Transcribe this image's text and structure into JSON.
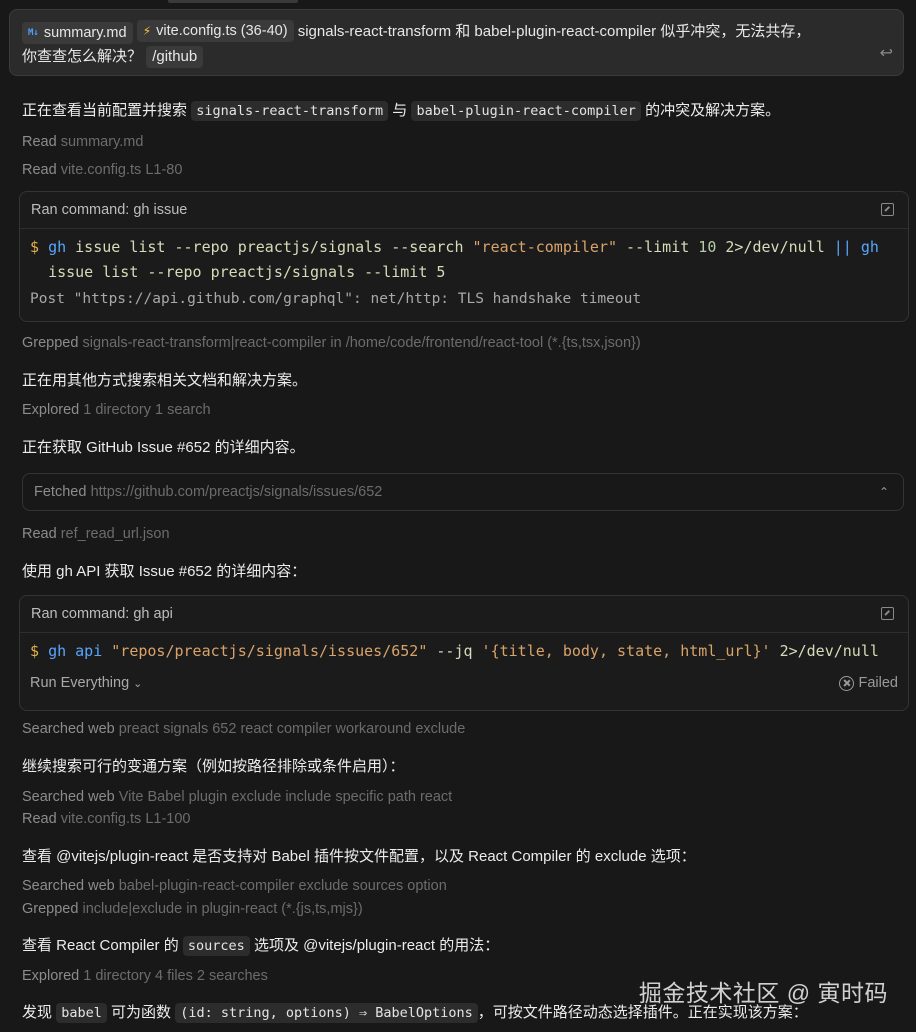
{
  "prompt": {
    "chip1": {
      "icon": "M↓",
      "label": "summary.md"
    },
    "chip2": {
      "icon": "⚡",
      "label": "vite.config.ts (36-40)"
    },
    "text_a": "signals-react-transform 和 babel-plugin-react-compiler 似乎冲突，无法共存，",
    "text_b": "你查查怎么解决？",
    "command_chip": "/github"
  },
  "m1": {
    "pre": "正在查看当前配置并搜索",
    "c1": "signals-react-transform",
    "mid": "与",
    "c2": "babel-plugin-react-compiler",
    "post": "的冲突及解决方案。"
  },
  "read1": {
    "verb": "Read",
    "detail": "summary.md"
  },
  "read2": {
    "verb": "Read",
    "detail": "vite.config.ts L1-80"
  },
  "card1": {
    "title": "Ran command: gh issue",
    "dollar": "$",
    "t1": "gh",
    "t2": "issue list --repo preactjs/signals --search",
    "t3": "\"react-compiler\"",
    "t4": "--limit",
    "t5": "10",
    "t6": "2>/dev/null",
    "t7": "||",
    "t8": "gh",
    "t9": "issue list --repo preactjs/signals --limit 5",
    "output": "Post \"https://api.github.com/graphql\": net/http: TLS handshake timeout"
  },
  "grep1": {
    "verb": "Grepped",
    "detail": "signals-react-transform|react-compiler in /home/code/frontend/react-tool (*.{ts,tsx,json})"
  },
  "m2": "正在用其他方式搜索相关文档和解决方案。",
  "explored1": {
    "verb": "Explored",
    "detail": "1 directory 1 search"
  },
  "m3": "正在获取 GitHub Issue #652 的详细内容。",
  "fetched": {
    "verb": "Fetched",
    "detail": "https://github.com/preactjs/signals/issues/652"
  },
  "read3": {
    "verb": "Read",
    "detail": "ref_read_url.json"
  },
  "m4": "使用 gh API 获取 Issue #652 的详细内容：",
  "card2": {
    "title": "Ran command: gh api",
    "dollar": "$",
    "t1": "gh",
    "t2": "api",
    "t3": "\"repos/preactjs/signals/issues/652\"",
    "t4": "--jq",
    "t5": "'{title, body, state, html_url}'",
    "t6": "2>/dev/null",
    "run_label": "Run Everything",
    "status": "Failed"
  },
  "search1": {
    "verb": "Searched web",
    "detail": "preact signals 652 react compiler workaround exclude"
  },
  "m5": "继续搜索可行的变通方案（例如按路径排除或条件启用）：",
  "search2": {
    "verb": "Searched web",
    "detail": "Vite Babel plugin exclude include specific path react"
  },
  "read4": {
    "verb": "Read",
    "detail": "vite.config.ts L1-100"
  },
  "m6": "查看 @vitejs/plugin-react 是否支持对 Babel 插件按文件配置，以及 React Compiler 的 exclude 选项：",
  "search3": {
    "verb": "Searched web",
    "detail": "babel-plugin-react-compiler exclude sources option"
  },
  "grep2": {
    "verb": "Grepped",
    "detail": "include|exclude in plugin-react (*.{js,ts,mjs})"
  },
  "m7": {
    "pre": "查看 React Compiler 的",
    "c1": "sources",
    "post": "选项及 @vitejs/plugin-react 的用法："
  },
  "explored2": {
    "verb": "Explored",
    "detail": "1 directory 4 files 2 searches"
  },
  "m8": {
    "pre": "发现",
    "c1": "babel",
    "mid": "可为函数",
    "c2": "(id: string, options) ⇒ BabelOptions",
    "post": "，可按文件路径动态选择插件。正在实现该方案："
  },
  "watermark": "掘金技术社区 @ 寅时码"
}
